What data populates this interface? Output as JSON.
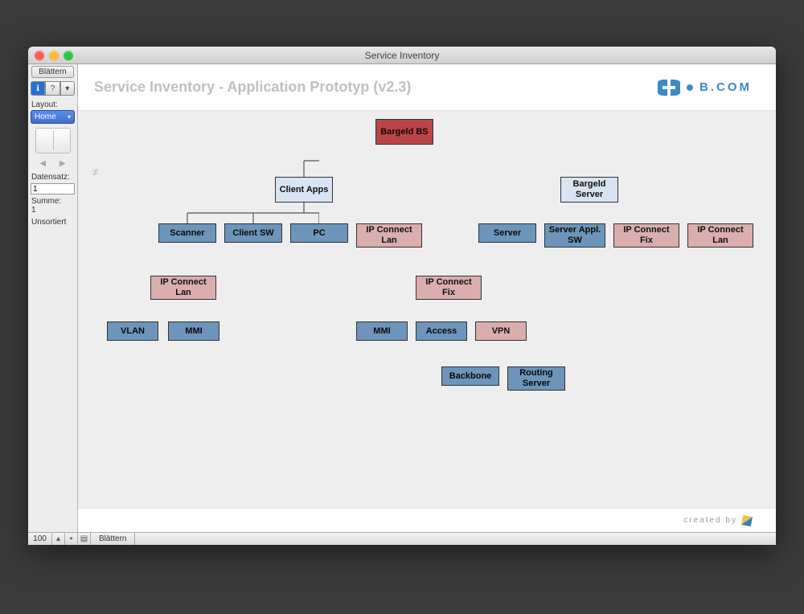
{
  "window": {
    "title": "Service Inventory"
  },
  "sidebar": {
    "mode_tab": "Blättern",
    "layout_label": "Layout:",
    "layout_value": "Home",
    "record_label": "Datensatz:",
    "record_value": "1",
    "sum_label": "Summe:",
    "sum_value": "1",
    "sort_status": "Unsortiert",
    "tool_icons": [
      "info-icon",
      "help-icon",
      "dropdown-icon"
    ]
  },
  "header": {
    "title": "Service Inventory - Application Prototyp (v2.3)",
    "brand": "B.COM"
  },
  "footer": {
    "created_by": "created by"
  },
  "statusbar": {
    "zoom": "100",
    "tab": "Blättern"
  },
  "colors": {
    "node_red": "#b84646",
    "node_lightblue": "#d9e4f2",
    "node_blue": "#6d95bb",
    "node_pink": "#d9aead"
  },
  "chart_data": {
    "type": "tree",
    "title": "Service Inventory - Application Prototyp (v2.3)",
    "root": {
      "label": "Bargeld BS",
      "color": "red",
      "children": [
        {
          "label": "Client Apps",
          "color": "lightblue",
          "children": [
            {
              "label": "Scanner",
              "color": "blue"
            },
            {
              "label": "Client SW",
              "color": "blue"
            },
            {
              "label": "PC",
              "color": "blue"
            },
            {
              "label": "IP Connect Lan",
              "color": "pink",
              "children": [
                {
                  "label": "IP Connect Lan",
                  "color": "pink",
                  "children": [
                    {
                      "label": "VLAN",
                      "color": "blue"
                    },
                    {
                      "label": "MMI",
                      "color": "blue"
                    }
                  ]
                },
                {
                  "label": "IP Connect Fix",
                  "color": "pink",
                  "children": [
                    {
                      "label": "MMI",
                      "color": "blue"
                    },
                    {
                      "label": "Access",
                      "color": "blue"
                    },
                    {
                      "label": "VPN",
                      "color": "pink",
                      "children": [
                        {
                          "label": "Backbone",
                          "color": "blue"
                        },
                        {
                          "label": "Routing Server",
                          "color": "blue"
                        }
                      ]
                    }
                  ]
                }
              ]
            }
          ]
        },
        {
          "label": "Bargeld Server",
          "color": "lightblue",
          "children": [
            {
              "label": "Server",
              "color": "blue"
            },
            {
              "label": "Server Appl. SW",
              "color": "blue"
            },
            {
              "label": "IP Connect Fix",
              "color": "pink"
            },
            {
              "label": "IP Connect Lan",
              "color": "pink"
            }
          ]
        }
      ]
    },
    "nodes_flat": [
      {
        "id": "root",
        "label": "Bargeld BS",
        "color": "red",
        "parent": null
      },
      {
        "id": "ca",
        "label": "Client Apps",
        "color": "lightblue",
        "parent": "root"
      },
      {
        "id": "bs",
        "label": "Bargeld Server",
        "color": "lightblue",
        "parent": "root"
      },
      {
        "id": "ca1",
        "label": "Scanner",
        "color": "blue",
        "parent": "ca"
      },
      {
        "id": "ca2",
        "label": "Client SW",
        "color": "blue",
        "parent": "ca"
      },
      {
        "id": "ca3",
        "label": "PC",
        "color": "blue",
        "parent": "ca"
      },
      {
        "id": "ca4",
        "label": "IP Connect Lan",
        "color": "pink",
        "parent": "ca"
      },
      {
        "id": "bs1",
        "label": "Server",
        "color": "blue",
        "parent": "bs"
      },
      {
        "id": "bs2",
        "label": "Server Appl. SW",
        "color": "blue",
        "parent": "bs"
      },
      {
        "id": "bs3",
        "label": "IP Connect Fix",
        "color": "pink",
        "parent": "bs"
      },
      {
        "id": "bs4",
        "label": "IP Connect Lan",
        "color": "pink",
        "parent": "bs"
      },
      {
        "id": "ipl",
        "label": "IP Connect Lan",
        "color": "pink",
        "parent": "ca4"
      },
      {
        "id": "ipf",
        "label": "IP Connect Fix",
        "color": "pink",
        "parent": "ca4"
      },
      {
        "id": "ipl1",
        "label": "VLAN",
        "color": "blue",
        "parent": "ipl"
      },
      {
        "id": "ipl2",
        "label": "MMI",
        "color": "blue",
        "parent": "ipl"
      },
      {
        "id": "ipf1",
        "label": "MMI",
        "color": "blue",
        "parent": "ipf"
      },
      {
        "id": "ipf2",
        "label": "Access",
        "color": "blue",
        "parent": "ipf"
      },
      {
        "id": "ipf3",
        "label": "VPN",
        "color": "pink",
        "parent": "ipf"
      },
      {
        "id": "vpn1",
        "label": "Backbone",
        "color": "blue",
        "parent": "ipf3"
      },
      {
        "id": "vpn2",
        "label": "Routing Server",
        "color": "blue",
        "parent": "ipf3"
      }
    ]
  }
}
